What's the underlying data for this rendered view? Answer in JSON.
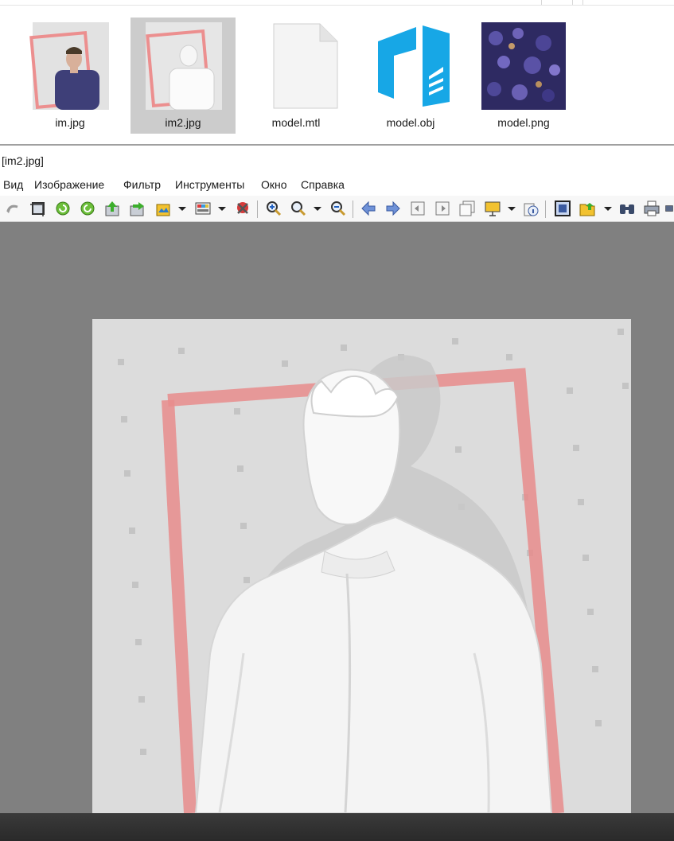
{
  "explorer": {
    "files": [
      {
        "name": "im.jpg",
        "icon": "photo-thumbnail-icon",
        "selected": false
      },
      {
        "name": "im2.jpg",
        "icon": "photo-thumbnail-icon",
        "selected": true
      },
      {
        "name": "model.mtl",
        "icon": "blank-file-icon",
        "selected": false
      },
      {
        "name": "model.obj",
        "icon": "3d-object-file-icon",
        "selected": false
      },
      {
        "name": "model.png",
        "icon": "texture-thumbnail-icon",
        "selected": false
      }
    ],
    "selection_color": "#cccccc"
  },
  "viewer": {
    "title": "[im2.jpg]",
    "menu": [
      "Вид",
      "Изображение",
      "Фильтр",
      "Инструменты",
      "Окно",
      "Справка"
    ],
    "toolbar_icons": [
      "undo-icon",
      "crop-icon",
      "rotate-left-icon",
      "rotate-right-icon",
      "open-icon",
      "save-icon",
      "batch-convert-icon",
      "color-palette-icon",
      "red-eye-icon",
      "zoom-in-icon",
      "zoom-original-icon",
      "zoom-out-icon",
      "previous-icon",
      "next-icon",
      "first-page-icon",
      "next-page-icon",
      "page-icon",
      "slideshow-icon",
      "info-icon",
      "fit-window-icon",
      "open-folder-icon",
      "search-icon",
      "print-icon",
      "scan-icon"
    ],
    "canvas_color": "#808080",
    "image_bg_color": "#dcdcdc",
    "frame_color": "#e88c8c"
  }
}
